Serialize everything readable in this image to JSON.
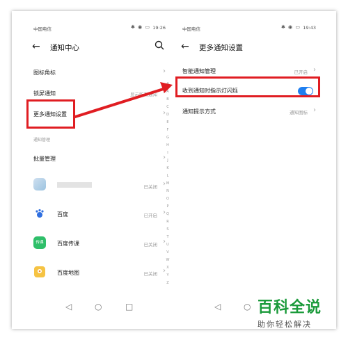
{
  "left": {
    "status": {
      "carrier": "中国电信",
      "time": "19:26",
      "icons": "✱ ◉ ▭"
    },
    "header": {
      "title": "通知中心"
    },
    "rows": [
      {
        "label": "图标角标",
        "value": ""
      },
      {
        "label": "锁屏通知",
        "value": "显示所有通知"
      },
      {
        "label": "更多通知设置",
        "value": ""
      }
    ],
    "section": "通知管理",
    "batch": {
      "label": "批量管理"
    },
    "apps": [
      {
        "name": "",
        "status": "已关闭"
      },
      {
        "name": "百度",
        "status": "已开启"
      },
      {
        "name": "百度传课",
        "status": "已关闭"
      },
      {
        "name": "百度地图",
        "status": "已关闭"
      }
    ],
    "app_icon_text": {
      "chuanke": "传课"
    },
    "alpha": [
      "#",
      "A",
      "B",
      "C",
      "D",
      "E",
      "F",
      "G",
      "H",
      "I",
      "J",
      "K",
      "L",
      "M",
      "N",
      "O",
      "P",
      "Q",
      "R",
      "S",
      "T",
      "U",
      "V",
      "W",
      "X",
      "Y",
      "Z"
    ]
  },
  "right": {
    "status": {
      "carrier": "中国电信",
      "time": "19:43",
      "icons": "✱ ◉ ▭"
    },
    "header": {
      "title": "更多通知设置"
    },
    "rows": [
      {
        "label": "智能通知管理",
        "value": "已开启"
      },
      {
        "label": "收到通知时指示灯闪烁",
        "value": ""
      },
      {
        "label": "通知提示方式",
        "value": "通知图标"
      }
    ]
  },
  "nav": {
    "back": "◁",
    "home": "○",
    "recent": "□"
  },
  "watermark": {
    "title": "百科全说",
    "subtitle": "助你轻松解决"
  },
  "colors": {
    "highlight": "#e01d22",
    "accent": "#1f7ff0",
    "brand": "#1a9a3a"
  }
}
